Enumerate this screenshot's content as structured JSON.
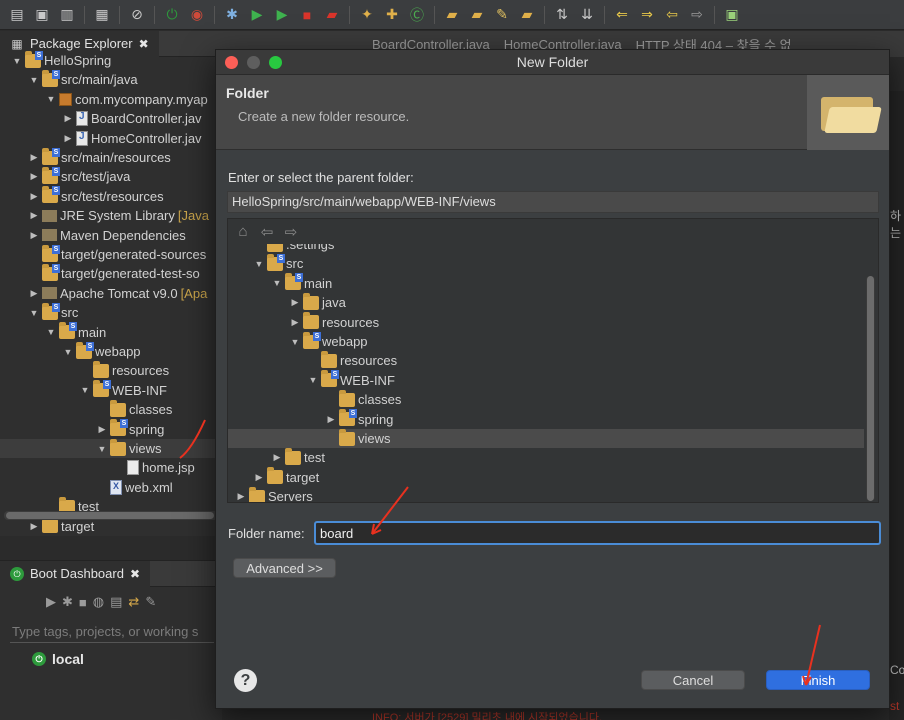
{
  "explorer": {
    "tab_label": "Package Explorer",
    "close_glyph": "✖",
    "tree": [
      {
        "label": "HelloSpring",
        "depth": 0,
        "open": true,
        "icon": "project"
      },
      {
        "label": "src/main/java",
        "depth": 1,
        "open": true,
        "icon": "src-folder"
      },
      {
        "label": "com.mycompany.myap",
        "depth": 2,
        "open": true,
        "icon": "package"
      },
      {
        "label": "BoardController.jav",
        "depth": 3,
        "open": false,
        "icon": "java"
      },
      {
        "label": "HomeController.jav",
        "depth": 3,
        "open": false,
        "icon": "java"
      },
      {
        "label": "src/main/resources",
        "depth": 1,
        "open": false,
        "icon": "src-folder"
      },
      {
        "label": "src/test/java",
        "depth": 1,
        "open": false,
        "icon": "src-folder"
      },
      {
        "label": "src/test/resources",
        "depth": 1,
        "open": false,
        "icon": "src-folder"
      },
      {
        "label": "JRE System Library",
        "suffix": "[Java",
        "depth": 1,
        "open": false,
        "icon": "library"
      },
      {
        "label": "Maven Dependencies",
        "depth": 1,
        "open": false,
        "icon": "library"
      },
      {
        "label": "target/generated-sources",
        "depth": 1,
        "open": null,
        "icon": "src-folder"
      },
      {
        "label": "target/generated-test-so",
        "depth": 1,
        "open": null,
        "icon": "src-folder"
      },
      {
        "label": "Apache Tomcat v9.0",
        "suffix": "[Apa",
        "depth": 1,
        "open": false,
        "icon": "library"
      },
      {
        "label": "src",
        "depth": 1,
        "open": true,
        "icon": "folder-s"
      },
      {
        "label": "main",
        "depth": 2,
        "open": true,
        "icon": "folder-s"
      },
      {
        "label": "webapp",
        "depth": 3,
        "open": true,
        "icon": "folder-s"
      },
      {
        "label": "resources",
        "depth": 4,
        "open": null,
        "icon": "folder"
      },
      {
        "label": "WEB-INF",
        "depth": 4,
        "open": true,
        "icon": "folder-s"
      },
      {
        "label": "classes",
        "depth": 5,
        "open": null,
        "icon": "folder"
      },
      {
        "label": "spring",
        "depth": 5,
        "open": false,
        "icon": "folder-s"
      },
      {
        "label": "views",
        "depth": 5,
        "open": true,
        "icon": "folder",
        "selected": true
      },
      {
        "label": "home.jsp",
        "depth": 6,
        "open": null,
        "icon": "jsp"
      },
      {
        "label": "web.xml",
        "depth": 5,
        "open": null,
        "icon": "xml"
      },
      {
        "label": "test",
        "depth": 2,
        "open": null,
        "icon": "folder"
      },
      {
        "label": "target",
        "depth": 1,
        "open": false,
        "icon": "folder"
      }
    ]
  },
  "boot": {
    "tab_label": "Boot Dashboard",
    "close_glyph": "✖",
    "search_placeholder": "Type tags, projects, or working s",
    "local_label": "local"
  },
  "editor": {
    "tabs": [
      "BoardController.java",
      "HomeController.java",
      "HTTP 상태 404 – 찾을 수 없"
    ],
    "side_text_1": "하는",
    "side_text_2": "Co",
    "side_text_3": "st",
    "bottom_text": "INFO: 서버가 [2529] 밀리초 내에 시작되었습니다."
  },
  "dialog": {
    "title": "New Folder",
    "banner_title": "Folder",
    "banner_desc": "Create a new folder resource.",
    "parent_label": "Enter or select the parent folder:",
    "parent_path": "HelloSpring/src/main/webapp/WEB-INF/views",
    "tree": [
      {
        "label": ".settings",
        "depth": 1,
        "open": null,
        "icon": "folder"
      },
      {
        "label": "src",
        "depth": 1,
        "open": true,
        "icon": "folder-s"
      },
      {
        "label": "main",
        "depth": 2,
        "open": true,
        "icon": "folder-s"
      },
      {
        "label": "java",
        "depth": 3,
        "open": false,
        "icon": "folder"
      },
      {
        "label": "resources",
        "depth": 3,
        "open": false,
        "icon": "folder"
      },
      {
        "label": "webapp",
        "depth": 3,
        "open": true,
        "icon": "folder-s"
      },
      {
        "label": "resources",
        "depth": 4,
        "open": null,
        "icon": "folder"
      },
      {
        "label": "WEB-INF",
        "depth": 4,
        "open": true,
        "icon": "folder-s"
      },
      {
        "label": "classes",
        "depth": 5,
        "open": null,
        "icon": "folder"
      },
      {
        "label": "spring",
        "depth": 5,
        "open": false,
        "icon": "folder-s"
      },
      {
        "label": "views",
        "depth": 5,
        "open": null,
        "icon": "folder",
        "selected": true
      },
      {
        "label": "test",
        "depth": 2,
        "open": false,
        "icon": "folder"
      },
      {
        "label": "target",
        "depth": 1,
        "open": false,
        "icon": "folder"
      },
      {
        "label": "Servers",
        "depth": 0,
        "open": false,
        "icon": "folder"
      }
    ],
    "folder_name_label": "Folder name:",
    "folder_name_value": "board",
    "advanced_label": "Advanced >>",
    "cancel_label": "Cancel",
    "finish_label": "Finish",
    "help_glyph": "?"
  },
  "colors": {
    "accent": "#2f6fe0",
    "focus_ring": "#4a8cd6",
    "annotation": "#e8311f"
  }
}
